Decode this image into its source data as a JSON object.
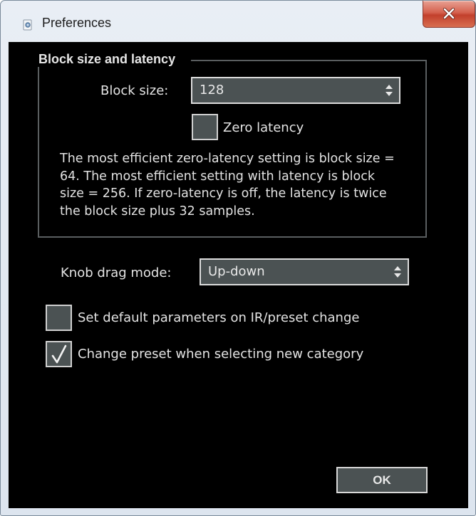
{
  "window": {
    "title": "Preferences",
    "icon": "app-icon",
    "close_icon": "close-icon"
  },
  "block_group": {
    "legend": "Block size and latency",
    "block_size_label": "Block size:",
    "block_size_value": "128",
    "zero_latency_label": "Zero latency",
    "zero_latency_checked": false,
    "info_text": "The most efficient zero-latency setting is block size = 64. The most efficient setting with latency is block size = 256. If zero-latency is off, the latency is twice the block size plus 32 samples."
  },
  "knob": {
    "label": "Knob drag mode:",
    "value": "Up-down"
  },
  "options": [
    {
      "label": "Set default parameters on IR/preset change",
      "checked": false
    },
    {
      "label": "Change preset when selecting new category",
      "checked": true
    }
  ],
  "ok_label": "OK",
  "colors": {
    "client_background": "#000000",
    "control_fill": "#4b5253",
    "control_border": "#dcdcdc",
    "text": "#e4e4e4",
    "close_button": "#c94a35"
  }
}
